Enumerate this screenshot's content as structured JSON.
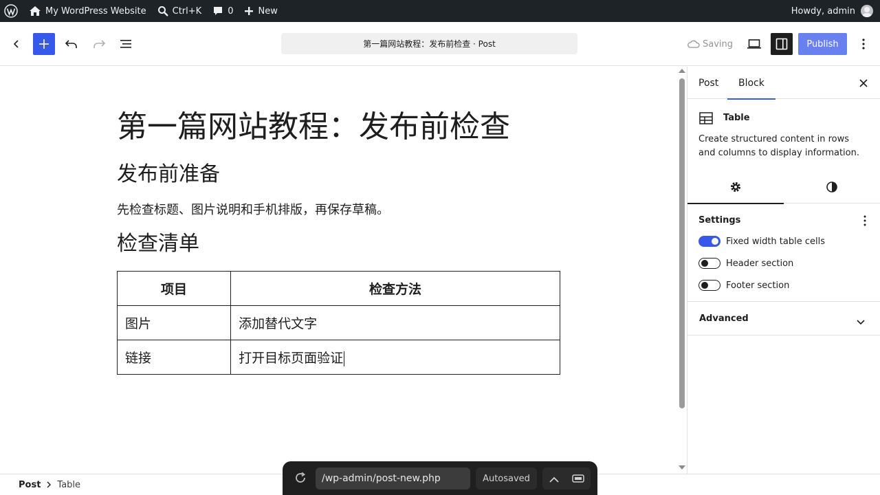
{
  "admin_bar": {
    "site_name": "My WordPress Website",
    "shortcut": "Ctrl+K",
    "comments_count": "0",
    "new_label": "New",
    "greeting": "Howdy, admin"
  },
  "header": {
    "document_title": "第一篇网站教程：发布前检查 · Post",
    "saving_label": "Saving",
    "publish_label": "Publish"
  },
  "content": {
    "post_title": "第一篇网站教程：发布前检查",
    "heading_1": "发布前准备",
    "paragraph": "先检查标题、图片说明和手机排版，再保存草稿。",
    "heading_2": "检查清单",
    "table": {
      "headers": [
        "项目",
        "检查方法"
      ],
      "rows": [
        [
          "图片",
          "添加替代文字"
        ],
        [
          "链接",
          "打开目标页面验证"
        ]
      ]
    }
  },
  "sidebar": {
    "tabs": [
      "Post",
      "Block"
    ],
    "active_tab": "Block",
    "block": {
      "name": "Table",
      "description": "Create structured content in rows and columns to display information."
    },
    "settings": {
      "title": "Settings",
      "toggles": [
        {
          "label": "Fixed width table cells",
          "on": true
        },
        {
          "label": "Header section",
          "on": false
        },
        {
          "label": "Footer section",
          "on": false
        }
      ]
    },
    "advanced_title": "Advanced"
  },
  "footer": {
    "breadcrumb": [
      "Post",
      "Table"
    ]
  },
  "browser_bar": {
    "url": "/wp-admin/post-new.php",
    "status": "Autosaved"
  },
  "colors": {
    "accent": "#3858e9",
    "admin_bar": "#1d2327"
  }
}
